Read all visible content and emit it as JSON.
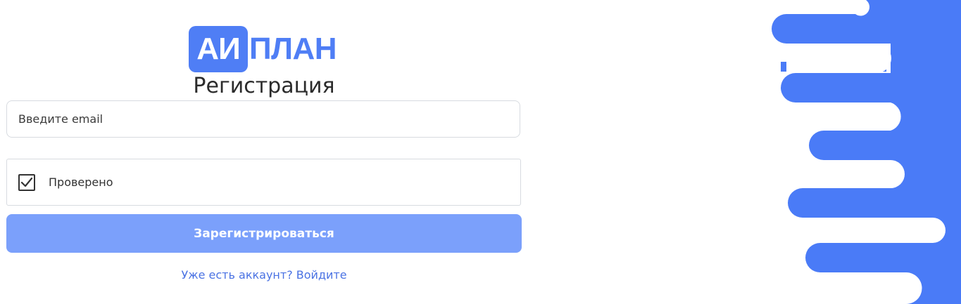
{
  "logo": {
    "box_text": "АИ",
    "text": "ПЛАН"
  },
  "form": {
    "title": "Регистрация",
    "email_placeholder": "Введите email",
    "email_value": "",
    "captcha_label": "Проверено",
    "captcha_checked": true,
    "submit_label": "Зарегистрироваться",
    "login_prompt": "Уже есть аккаунт? Войдите"
  },
  "colors": {
    "accent": "#4f7ef5",
    "button": "#7ba0fb",
    "link": "#4a72e3",
    "decor": "#4a7bf7"
  },
  "decor": {
    "icon": "wavy-shape-decoration"
  }
}
